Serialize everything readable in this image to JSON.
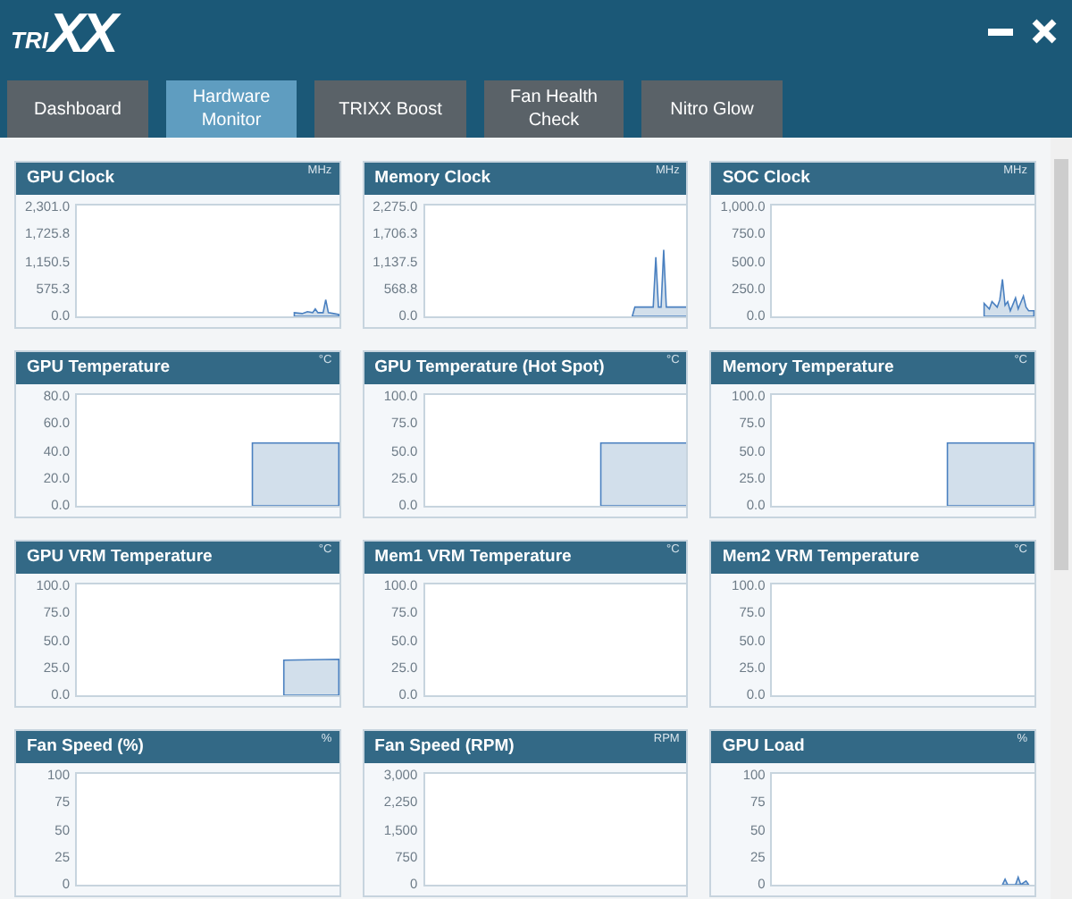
{
  "logo": {
    "small": "TRI",
    "large": "XX"
  },
  "tabs": [
    {
      "label": "Dashboard",
      "selected": false
    },
    {
      "label": "Hardware Monitor",
      "selected": true
    },
    {
      "label": "TRIXX Boost",
      "selected": false
    },
    {
      "label": "Fan Health Check",
      "selected": false
    },
    {
      "label": "Nitro Glow",
      "selected": false
    }
  ],
  "panels": [
    {
      "title": "GPU Clock",
      "unit": "MHz",
      "ticks": [
        "2,301.0",
        "1,725.8",
        "1,150.5",
        "575.3",
        "0.0"
      ],
      "kind": "noise"
    },
    {
      "title": "Memory Clock",
      "unit": "MHz",
      "ticks": [
        "2,275.0",
        "1,706.3",
        "1,137.5",
        "568.8",
        "0.0"
      ],
      "kind": "twin"
    },
    {
      "title": "SOC Clock",
      "unit": "MHz",
      "ticks": [
        "1,000.0",
        "750.0",
        "500.0",
        "250.0",
        "0.0"
      ],
      "kind": "burst"
    },
    {
      "title": "GPU Temperature",
      "unit": "°C",
      "ticks": [
        "80.0",
        "60.0",
        "40.0",
        "20.0",
        "0.0"
      ],
      "kind": "step"
    },
    {
      "title": "GPU Temperature (Hot Spot)",
      "unit": "°C",
      "ticks": [
        "100.0",
        "75.0",
        "50.0",
        "25.0",
        "0.0"
      ],
      "kind": "step"
    },
    {
      "title": "Memory Temperature",
      "unit": "°C",
      "ticks": [
        "100.0",
        "75.0",
        "50.0",
        "25.0",
        "0.0"
      ],
      "kind": "step"
    },
    {
      "title": "GPU VRM Temperature",
      "unit": "°C",
      "ticks": [
        "100.0",
        "75.0",
        "50.0",
        "25.0",
        "0.0"
      ],
      "kind": "low"
    },
    {
      "title": "Mem1 VRM Temperature",
      "unit": "°C",
      "ticks": [
        "100.0",
        "75.0",
        "50.0",
        "25.0",
        "0.0"
      ],
      "kind": "none"
    },
    {
      "title": "Mem2 VRM Temperature",
      "unit": "°C",
      "ticks": [
        "100.0",
        "75.0",
        "50.0",
        "25.0",
        "0.0"
      ],
      "kind": "none"
    },
    {
      "title": "Fan Speed (%)",
      "unit": "%",
      "ticks": [
        "100",
        "75",
        "50",
        "25",
        "0"
      ],
      "kind": "none"
    },
    {
      "title": "Fan Speed (RPM)",
      "unit": "RPM",
      "ticks": [
        "3,000",
        "2,250",
        "1,500",
        "750",
        "0"
      ],
      "kind": "none"
    },
    {
      "title": "GPU Load",
      "unit": "%",
      "ticks": [
        "100",
        "75",
        "50",
        "25",
        "0"
      ],
      "kind": "blip"
    }
  ]
}
